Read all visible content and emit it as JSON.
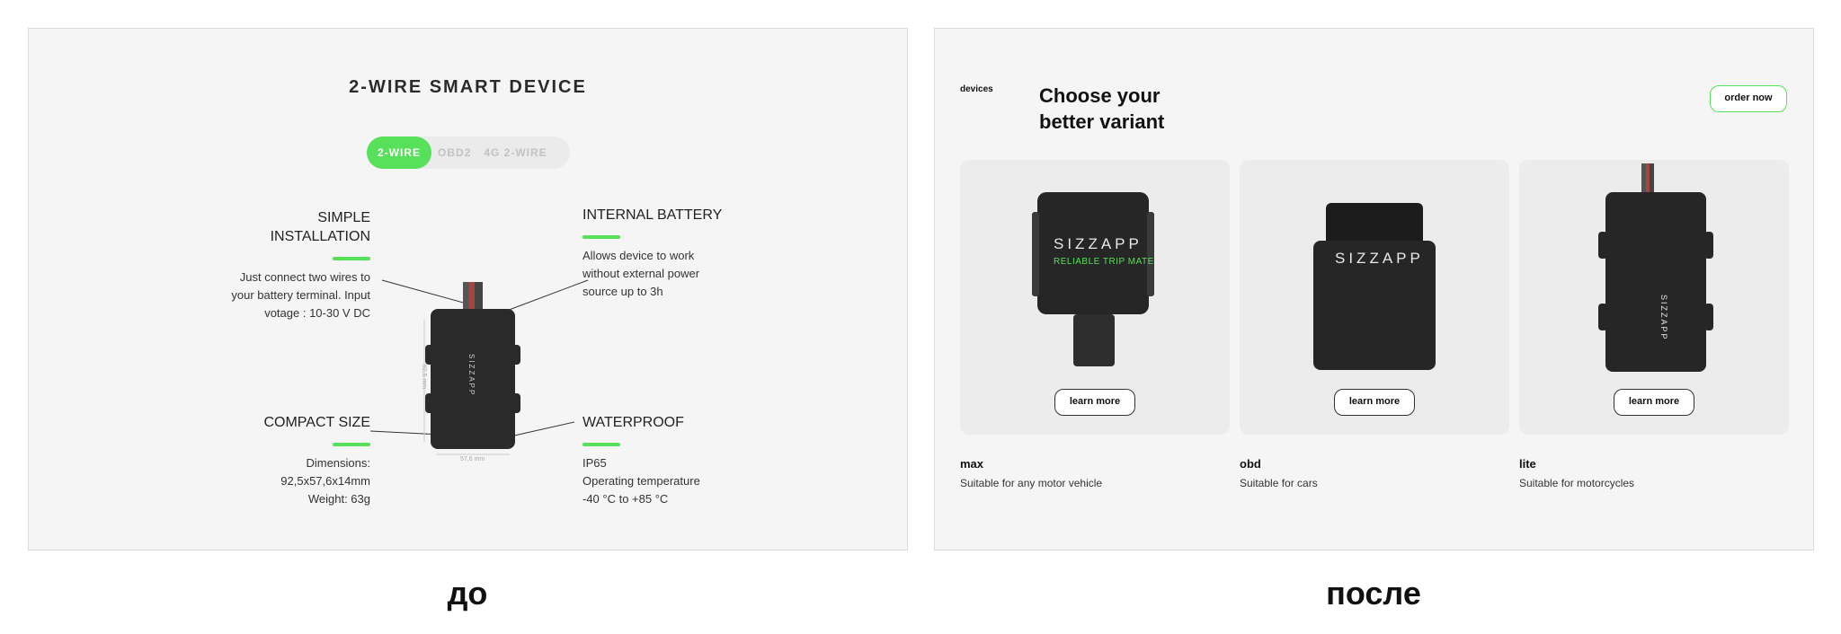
{
  "before": {
    "title": "2-WIRE SMART DEVICE",
    "tabs": [
      "2-WIRE",
      "OBD2",
      "4G 2-WIRE"
    ],
    "features": {
      "installation": {
        "title1": "SIMPLE",
        "title2": "INSTALLATION",
        "l1": "Just connect two wires to",
        "l2": "your battery terminal. Input",
        "l3": "votage : 10-30 V DC"
      },
      "battery": {
        "title": "INTERNAL BATTERY",
        "l1": "Allows device to work",
        "l2": "without external power",
        "l3": "source up to 3h"
      },
      "compact": {
        "title": "COMPACT SIZE",
        "l1": "Dimensions:",
        "l2": "92,5x57,6x14mm",
        "l3": "Weight: 63g"
      },
      "waterproof": {
        "title": "WATERPROOF",
        "l1": "IP65",
        "l2": "Operating temperature",
        "l3": "-40 °C to +85 °C"
      }
    },
    "device_logo": "SIZZAPP",
    "dim_h": "92,5 mm",
    "dim_w": "57,6 mm"
  },
  "after": {
    "label": "devices",
    "title1": "Choose your",
    "title2": "better variant",
    "order": "order now",
    "learn": "learn more",
    "brand": "SIZZAPP",
    "tagline": "RELIABLE TRIP MATE",
    "products": [
      {
        "name": "max",
        "desc": "Suitable for any motor vehicle"
      },
      {
        "name": "obd",
        "desc": "Suitable for cars"
      },
      {
        "name": "lite",
        "desc": "Suitable for motorcycles"
      }
    ]
  },
  "captions": {
    "before": "до",
    "after": "после"
  },
  "colors": {
    "accent": "#57e05a",
    "device": "#262626",
    "panel": "#f5f5f5"
  }
}
